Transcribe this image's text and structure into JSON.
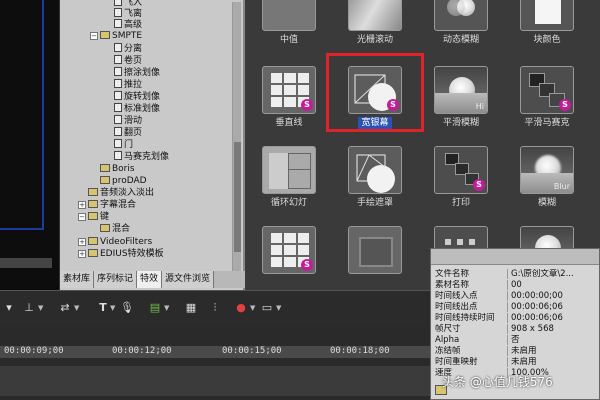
{
  "tree": {
    "items": [
      {
        "label": "飞入"
      },
      {
        "label": "飞离"
      },
      {
        "label": "高级"
      },
      {
        "label": "SMPTE"
      },
      {
        "label": "分离"
      },
      {
        "label": "卷页"
      },
      {
        "label": "擦涂划像"
      },
      {
        "label": "推拉"
      },
      {
        "label": "旋转划像"
      },
      {
        "label": "标准划像"
      },
      {
        "label": "滑动"
      },
      {
        "label": "翻页"
      },
      {
        "label": "门"
      },
      {
        "label": "马赛克划像"
      },
      {
        "label": "Boris"
      },
      {
        "label": "proDAD"
      },
      {
        "label": "音频淡入淡出"
      },
      {
        "label": "字幕混合"
      },
      {
        "label": "键"
      },
      {
        "label": "混合"
      },
      {
        "label": "VideoFilters"
      },
      {
        "label": "EDIUS特效模板"
      }
    ]
  },
  "tabs": [
    {
      "label": "素材库"
    },
    {
      "label": "序列标记"
    },
    {
      "label": "特效"
    },
    {
      "label": "源文件浏览"
    }
  ],
  "effects": [
    {
      "label": "中值",
      "icon": "median-effect-icon"
    },
    {
      "label": "光栅滚动",
      "icon": "raster-scroll-effect-icon"
    },
    {
      "label": "动态模糊",
      "icon": "motion-blur-effect-icon"
    },
    {
      "label": "块颜色",
      "icon": "block-color-effect-icon"
    },
    {
      "label": "垂直线",
      "icon": "vertical-lines-effect-icon"
    },
    {
      "label": "宽银幕",
      "icon": "widescreen-effect-icon"
    },
    {
      "label": "平滑模糊",
      "icon": "smooth-blur-effect-icon",
      "thumb_text": "Hi"
    },
    {
      "label": "平滑马赛克",
      "icon": "smooth-mosaic-effect-icon"
    },
    {
      "label": "循环幻灯",
      "icon": "loop-slide-effect-icon"
    },
    {
      "label": "手绘遮罩",
      "icon": "hand-drawn-mask-effect-icon"
    },
    {
      "label": "打印",
      "icon": "print-effect-icon"
    },
    {
      "label": "模糊",
      "icon": "blur-effect-icon",
      "thumb_text": "Blur"
    },
    {
      "label": "",
      "icon": "grid-effect-icon"
    },
    {
      "label": "",
      "icon": "frame-effect-icon"
    },
    {
      "label": "",
      "icon": "dots-effect-icon"
    },
    {
      "label": "",
      "icon": "glow-effect-icon"
    }
  ],
  "badge_letter": "S",
  "selected_effect": "宽银幕",
  "properties": [
    {
      "key": "文件名称",
      "value": "G:\\原创文章\\2..."
    },
    {
      "key": "素材名称",
      "value": "00"
    },
    {
      "key": "时间线入点",
      "value": "00:00:00;00"
    },
    {
      "key": "时间线出点",
      "value": "00:00:06;06"
    },
    {
      "key": "时间线持续时间",
      "value": "00:00:06;06"
    },
    {
      "key": "帧尺寸",
      "value": "908 x 568"
    },
    {
      "key": "Alpha",
      "value": "否"
    },
    {
      "key": "冻结帧",
      "value": "未启用"
    },
    {
      "key": "时间重映射",
      "value": "未启用"
    },
    {
      "key": "速度",
      "value": "100.00%"
    }
  ],
  "toolbar": {
    "text_tool_label": "T"
  },
  "timeline": {
    "timecodes": [
      "00:00:09;00",
      "00:00:12;00",
      "00:00:15;00",
      "00:00:18;00"
    ]
  },
  "watermark": "头条 @心值几钱576",
  "colors": {
    "selection_highlight": "#e0232a",
    "selected_label_bg": "#2a52b5",
    "badge": "#c21c9b"
  }
}
